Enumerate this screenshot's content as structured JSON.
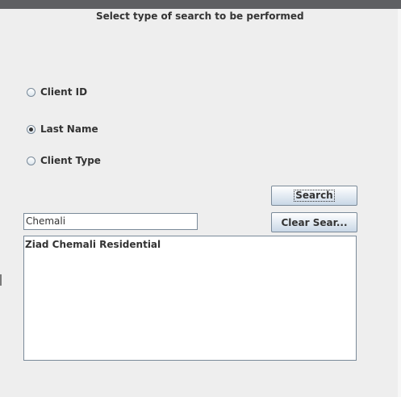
{
  "header": {
    "prompt": "Select type of search to be performed"
  },
  "search_options": [
    {
      "label": "Client ID",
      "selected": false
    },
    {
      "label": "Last Name",
      "selected": true
    },
    {
      "label": "Client Type",
      "selected": false
    }
  ],
  "buttons": {
    "search_label": "Search",
    "clear_label": "Clear Sear..."
  },
  "search_field": {
    "value": "Chemali"
  },
  "results": [
    "Ziad Chemali Residential"
  ]
}
